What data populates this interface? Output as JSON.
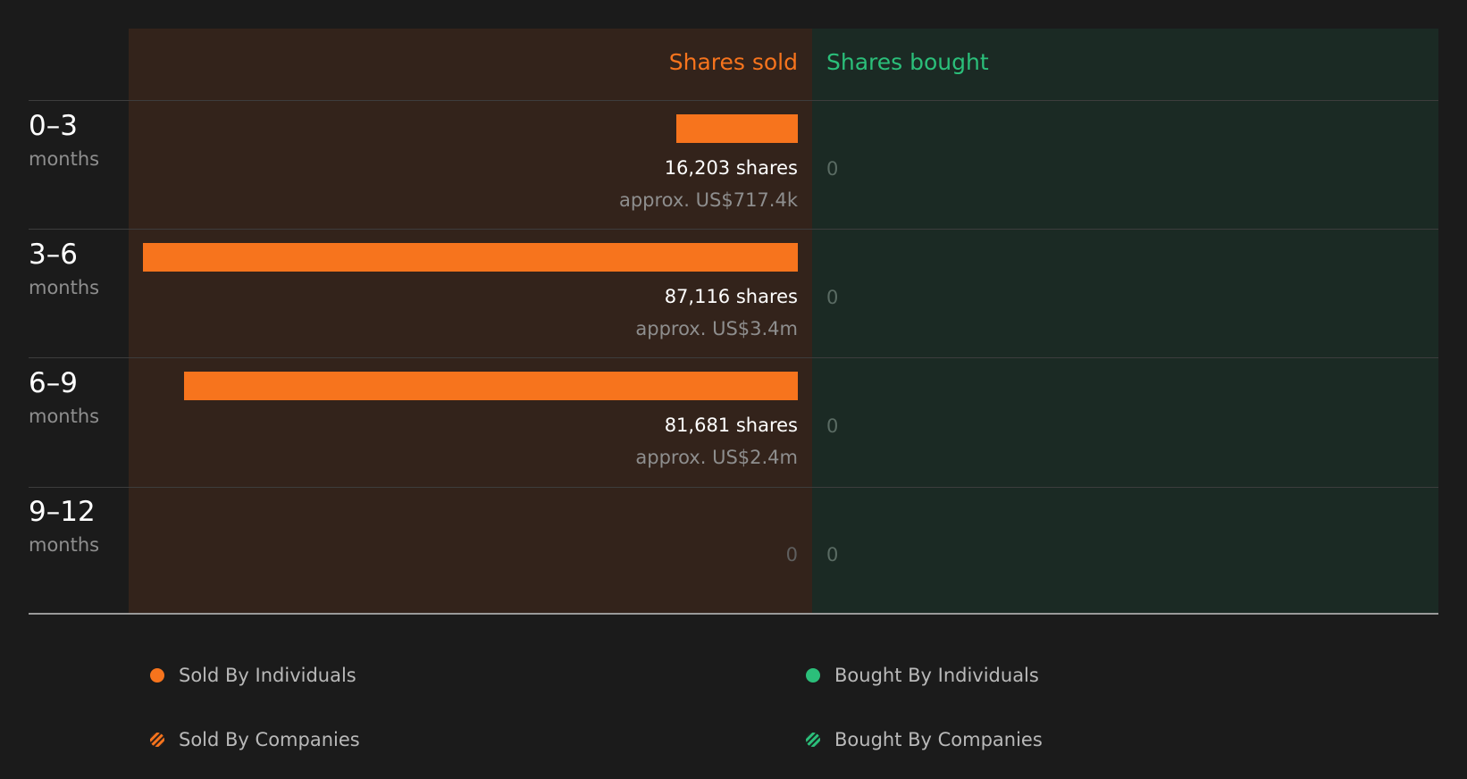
{
  "chart_data": {
    "type": "bar",
    "headers": {
      "sold": "Shares sold",
      "bought": "Shares bought"
    },
    "categories": [
      "0–3",
      "3–6",
      "6–9",
      "9–12"
    ],
    "category_unit": "months",
    "series": [
      {
        "name": "Shares sold",
        "values": [
          16203,
          87116,
          81681,
          0
        ]
      },
      {
        "name": "Shares bought",
        "values": [
          0,
          0,
          0,
          0
        ]
      }
    ],
    "rows": [
      {
        "range": "0–3",
        "unit": "months",
        "sold_shares": 16203,
        "sold_label": "16,203 shares",
        "sold_approx": "approx. US$717.4k",
        "bought": "0"
      },
      {
        "range": "3–6",
        "unit": "months",
        "sold_shares": 87116,
        "sold_label": "87,116 shares",
        "sold_approx": "approx. US$3.4m",
        "bought": "0"
      },
      {
        "range": "6–9",
        "unit": "months",
        "sold_shares": 81681,
        "sold_label": "81,681 shares",
        "sold_approx": "approx. US$2.4m",
        "bought": "0"
      },
      {
        "range": "9–12",
        "unit": "months",
        "sold_shares": 0,
        "sold_zero": "0",
        "bought": "0"
      }
    ],
    "legend": [
      {
        "label": "Sold By Individuals",
        "style": "solid",
        "color": "#f7741d"
      },
      {
        "label": "Sold By Companies",
        "style": "hatched",
        "color": "#f7741d"
      },
      {
        "label": "Bought By Individuals",
        "style": "solid",
        "color": "#2bbf7a"
      },
      {
        "label": "Bought By Companies",
        "style": "hatched",
        "color": "#2bbf7a"
      }
    ],
    "colors": {
      "sold": "#f7741d",
      "bought": "#2bbf7a",
      "sold_panel": "#33231b",
      "bought_panel": "#1b2a24",
      "background": "#1b1b1b"
    }
  }
}
